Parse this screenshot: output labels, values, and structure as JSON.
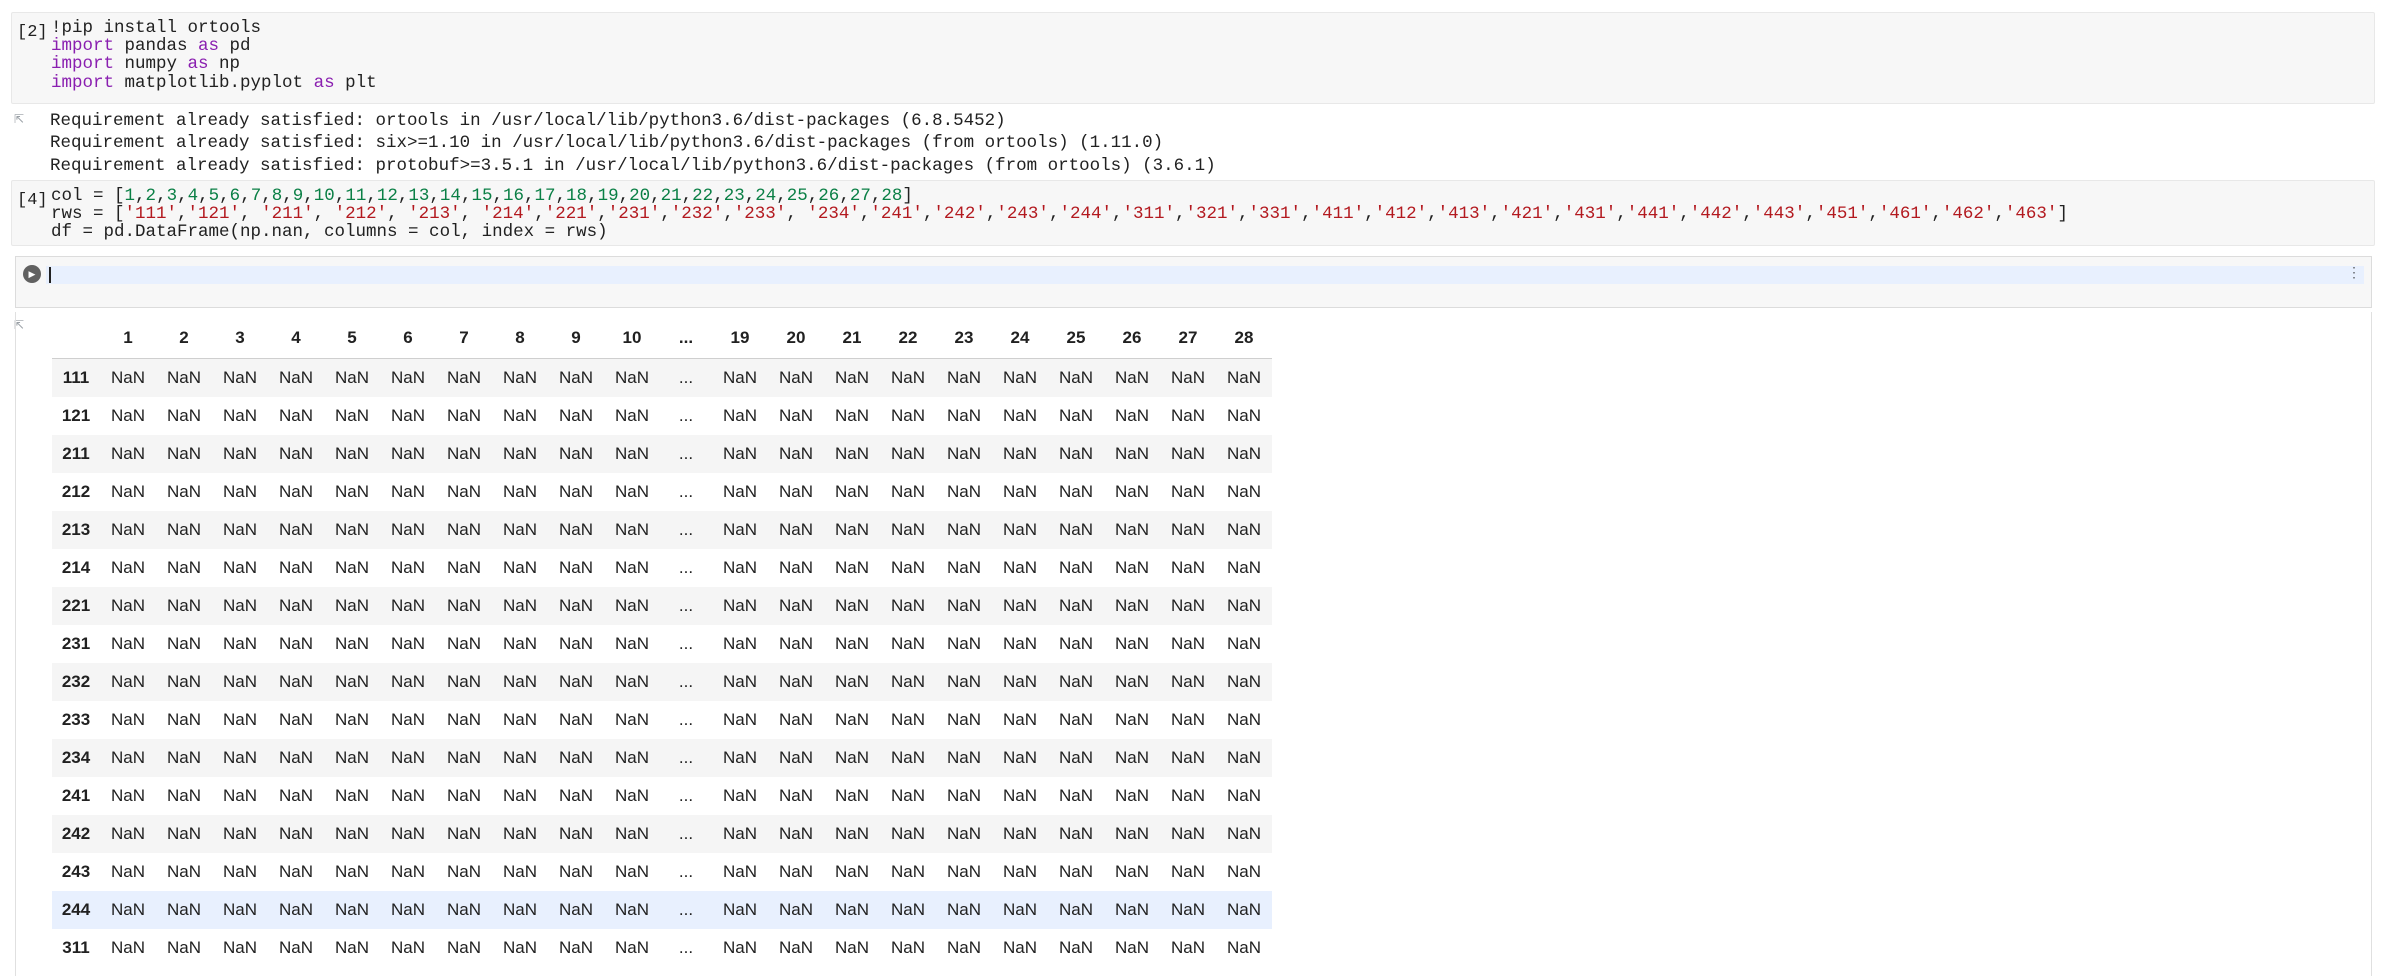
{
  "cells": [
    {
      "exec_count": "[2]",
      "code": [
        [
          {
            "t": "!pip install ortools",
            "c": ""
          }
        ],
        [
          {
            "t": "import",
            "c": "kw"
          },
          {
            "t": " pandas ",
            "c": ""
          },
          {
            "t": "as",
            "c": "kw"
          },
          {
            "t": " pd",
            "c": ""
          }
        ],
        [
          {
            "t": "import",
            "c": "kw"
          },
          {
            "t": " numpy ",
            "c": ""
          },
          {
            "t": "as",
            "c": "kw"
          },
          {
            "t": " np",
            "c": ""
          }
        ],
        [
          {
            "t": "import",
            "c": "kw"
          },
          {
            "t": " matplotlib.pyplot ",
            "c": ""
          },
          {
            "t": "as",
            "c": "kw"
          },
          {
            "t": " plt",
            "c": ""
          }
        ]
      ],
      "output": [
        "Requirement already satisfied: ortools in /usr/local/lib/python3.6/dist-packages (6.8.5452)",
        "Requirement already satisfied: six>=1.10 in /usr/local/lib/python3.6/dist-packages (from ortools) (1.11.0)",
        "Requirement already satisfied: protobuf>=3.5.1 in /usr/local/lib/python3.6/dist-packages (from ortools) (3.6.1)"
      ]
    },
    {
      "exec_count": "[4]",
      "code": [
        [
          {
            "t": "col = [",
            "c": ""
          },
          {
            "t": "1",
            "c": "num"
          },
          {
            "t": ",",
            "c": ""
          },
          {
            "t": "2",
            "c": "num"
          },
          {
            "t": ",",
            "c": ""
          },
          {
            "t": "3",
            "c": "num"
          },
          {
            "t": ",",
            "c": ""
          },
          {
            "t": "4",
            "c": "num"
          },
          {
            "t": ",",
            "c": ""
          },
          {
            "t": "5",
            "c": "num"
          },
          {
            "t": ",",
            "c": ""
          },
          {
            "t": "6",
            "c": "num"
          },
          {
            "t": ",",
            "c": ""
          },
          {
            "t": "7",
            "c": "num"
          },
          {
            "t": ",",
            "c": ""
          },
          {
            "t": "8",
            "c": "num"
          },
          {
            "t": ",",
            "c": ""
          },
          {
            "t": "9",
            "c": "num"
          },
          {
            "t": ",",
            "c": ""
          },
          {
            "t": "10",
            "c": "num"
          },
          {
            "t": ",",
            "c": ""
          },
          {
            "t": "11",
            "c": "num"
          },
          {
            "t": ",",
            "c": ""
          },
          {
            "t": "12",
            "c": "num"
          },
          {
            "t": ",",
            "c": ""
          },
          {
            "t": "13",
            "c": "num"
          },
          {
            "t": ",",
            "c": ""
          },
          {
            "t": "14",
            "c": "num"
          },
          {
            "t": ",",
            "c": ""
          },
          {
            "t": "15",
            "c": "num"
          },
          {
            "t": ",",
            "c": ""
          },
          {
            "t": "16",
            "c": "num"
          },
          {
            "t": ",",
            "c": ""
          },
          {
            "t": "17",
            "c": "num"
          },
          {
            "t": ",",
            "c": ""
          },
          {
            "t": "18",
            "c": "num"
          },
          {
            "t": ",",
            "c": ""
          },
          {
            "t": "19",
            "c": "num"
          },
          {
            "t": ",",
            "c": ""
          },
          {
            "t": "20",
            "c": "num"
          },
          {
            "t": ",",
            "c": ""
          },
          {
            "t": "21",
            "c": "num"
          },
          {
            "t": ",",
            "c": ""
          },
          {
            "t": "22",
            "c": "num"
          },
          {
            "t": ",",
            "c": ""
          },
          {
            "t": "23",
            "c": "num"
          },
          {
            "t": ",",
            "c": ""
          },
          {
            "t": "24",
            "c": "num"
          },
          {
            "t": ",",
            "c": ""
          },
          {
            "t": "25",
            "c": "num"
          },
          {
            "t": ",",
            "c": ""
          },
          {
            "t": "26",
            "c": "num"
          },
          {
            "t": ",",
            "c": ""
          },
          {
            "t": "27",
            "c": "num"
          },
          {
            "t": ",",
            "c": ""
          },
          {
            "t": "28",
            "c": "num"
          },
          {
            "t": "]",
            "c": ""
          }
        ],
        [
          {
            "t": "rws = [",
            "c": ""
          },
          {
            "t": "'111'",
            "c": "str"
          },
          {
            "t": ",",
            "c": ""
          },
          {
            "t": "'121'",
            "c": "str"
          },
          {
            "t": ", ",
            "c": ""
          },
          {
            "t": "'211'",
            "c": "str"
          },
          {
            "t": ", ",
            "c": ""
          },
          {
            "t": "'212'",
            "c": "str"
          },
          {
            "t": ", ",
            "c": ""
          },
          {
            "t": "'213'",
            "c": "str"
          },
          {
            "t": ", ",
            "c": ""
          },
          {
            "t": "'214'",
            "c": "str"
          },
          {
            "t": ",",
            "c": ""
          },
          {
            "t": "'221'",
            "c": "str"
          },
          {
            "t": ",",
            "c": ""
          },
          {
            "t": "'231'",
            "c": "str"
          },
          {
            "t": ",",
            "c": ""
          },
          {
            "t": "'232'",
            "c": "str"
          },
          {
            "t": ",",
            "c": ""
          },
          {
            "t": "'233'",
            "c": "str"
          },
          {
            "t": ", ",
            "c": ""
          },
          {
            "t": "'234'",
            "c": "str"
          },
          {
            "t": ",",
            "c": ""
          },
          {
            "t": "'241'",
            "c": "str"
          },
          {
            "t": ",",
            "c": ""
          },
          {
            "t": "'242'",
            "c": "str"
          },
          {
            "t": ",",
            "c": ""
          },
          {
            "t": "'243'",
            "c": "str"
          },
          {
            "t": ",",
            "c": ""
          },
          {
            "t": "'244'",
            "c": "str"
          },
          {
            "t": ",",
            "c": ""
          },
          {
            "t": "'311'",
            "c": "str"
          },
          {
            "t": ",",
            "c": ""
          },
          {
            "t": "'321'",
            "c": "str"
          },
          {
            "t": ",",
            "c": ""
          },
          {
            "t": "'331'",
            "c": "str"
          },
          {
            "t": ",",
            "c": ""
          },
          {
            "t": "'411'",
            "c": "str"
          },
          {
            "t": ",",
            "c": ""
          },
          {
            "t": "'412'",
            "c": "str"
          },
          {
            "t": ",",
            "c": ""
          },
          {
            "t": "'413'",
            "c": "str"
          },
          {
            "t": ",",
            "c": ""
          },
          {
            "t": "'421'",
            "c": "str"
          },
          {
            "t": ",",
            "c": ""
          },
          {
            "t": "'431'",
            "c": "str"
          },
          {
            "t": ",",
            "c": ""
          },
          {
            "t": "'441'",
            "c": "str"
          },
          {
            "t": ",",
            "c": ""
          },
          {
            "t": "'442'",
            "c": "str"
          },
          {
            "t": ",",
            "c": ""
          },
          {
            "t": "'443'",
            "c": "str"
          },
          {
            "t": ",",
            "c": ""
          },
          {
            "t": "'451'",
            "c": "str"
          },
          {
            "t": ",",
            "c": ""
          },
          {
            "t": "'461'",
            "c": "str"
          },
          {
            "t": ",",
            "c": ""
          },
          {
            "t": "'462'",
            "c": "str"
          },
          {
            "t": ",",
            "c": ""
          },
          {
            "t": "'463'",
            "c": "str"
          },
          {
            "t": "]",
            "c": ""
          }
        ],
        [
          {
            "t": "df = pd.DataFrame(np.nan, columns = col, index = rws)",
            "c": ""
          }
        ]
      ]
    }
  ],
  "active_cell": {
    "editor_text": "",
    "run_icon": "play-icon",
    "menu_icon": "more-vert-icon"
  },
  "dataframe": {
    "index_header": "",
    "columns": [
      "1",
      "2",
      "3",
      "4",
      "5",
      "6",
      "7",
      "8",
      "9",
      "10",
      "...",
      "19",
      "20",
      "21",
      "22",
      "23",
      "24",
      "25",
      "26",
      "27",
      "28"
    ],
    "index": [
      "111",
      "121",
      "211",
      "212",
      "213",
      "214",
      "221",
      "231",
      "232",
      "233",
      "234",
      "241",
      "242",
      "243",
      "244",
      "311"
    ],
    "cell_value": "NaN",
    "ellipsis": "...",
    "highlighted_row": "244"
  },
  "colors": {
    "keyword": "#8a1fb0",
    "number": "#0a7f45",
    "string": "#b3191f",
    "cell_bg": "#f7f7f7",
    "row_highlight": "#e8f0fe"
  }
}
